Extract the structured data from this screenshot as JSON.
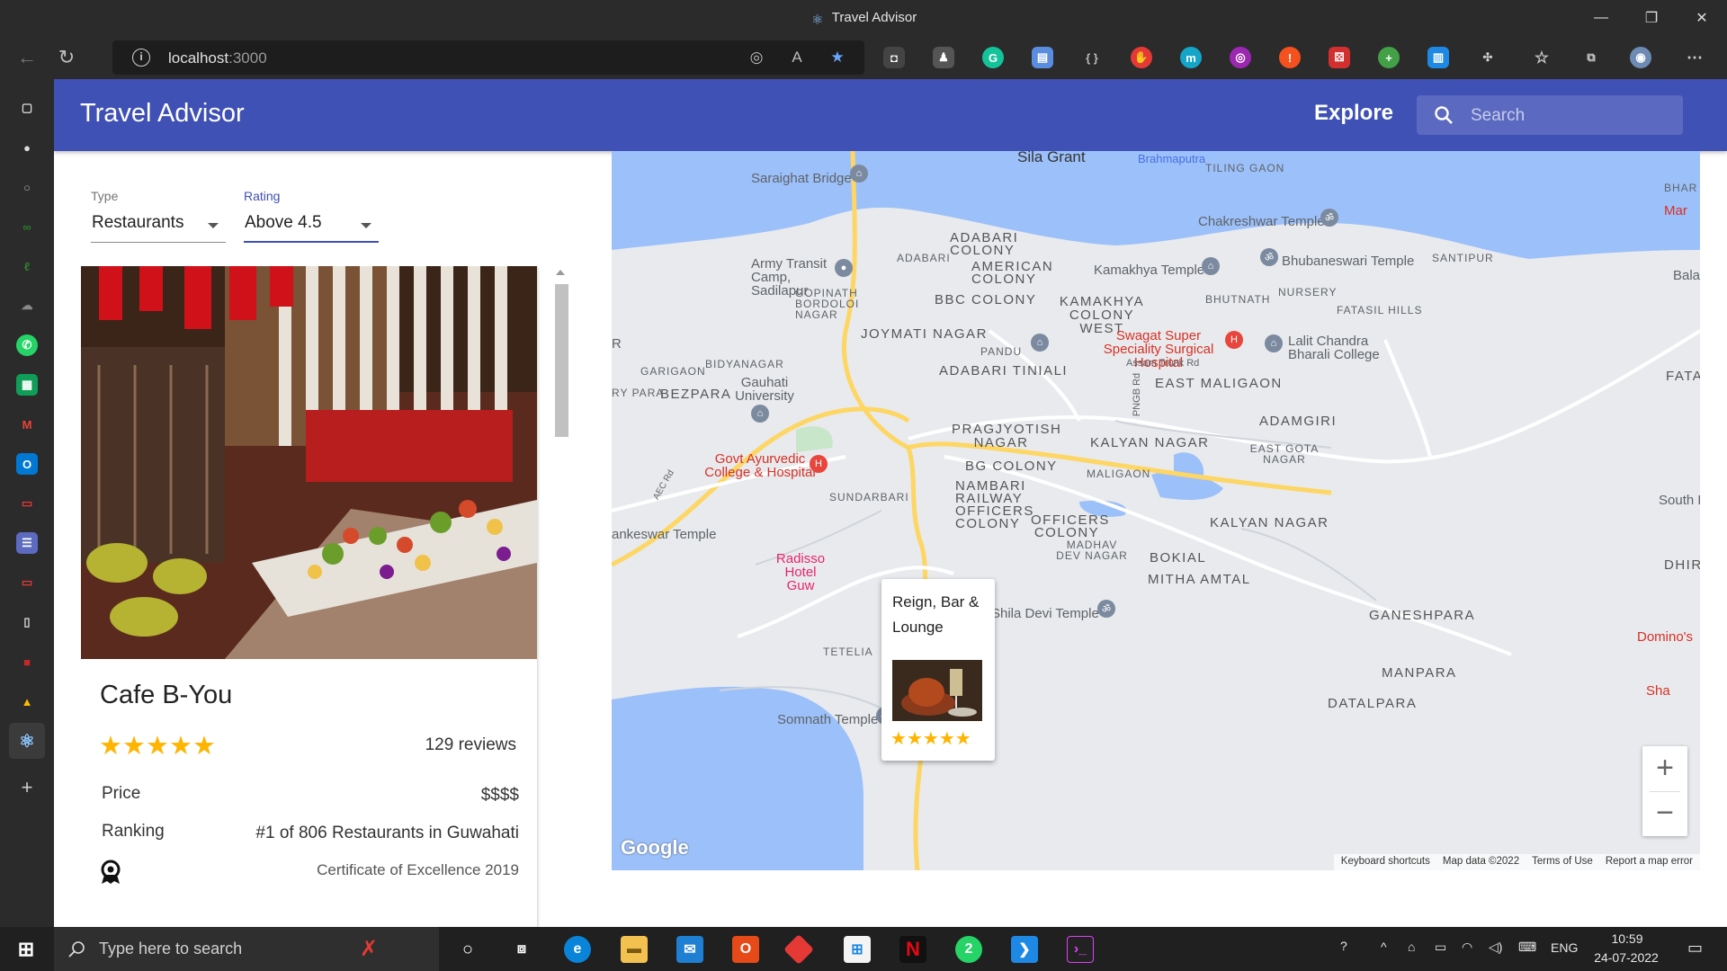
{
  "browser": {
    "window_title": "Travel Advisor",
    "url_host": "localhost",
    "url_port": ":3000"
  },
  "app": {
    "brand": "Travel Advisor",
    "explore_label": "Explore",
    "search_placeholder": "Search"
  },
  "filters": {
    "type_label": "Type",
    "type_value": "Restaurants",
    "rating_label": "Rating",
    "rating_value": "Above 4.5"
  },
  "place": {
    "name": "Cafe B-You",
    "rating_stars": 5,
    "reviews": "129 reviews",
    "price_label": "Price",
    "price_value": "$$$$",
    "ranking_label": "Ranking",
    "ranking_value": "#1 of 806 Restaurants in Guwahati",
    "award": "Certificate of Excellence 2019"
  },
  "map": {
    "popup": {
      "name": "Reign, Bar & Lounge",
      "rating_stars": 5
    },
    "labels": [
      "Sila Grant",
      "Saraighat Bridge",
      "Brahmaputra",
      "TILING GAON",
      "BHAR",
      "Mar",
      "Chakreshwar Temple",
      "ADABARI COLONY",
      "ADABARI",
      "AMERICAN COLONY",
      "Kamakhya Temple",
      "Bhubaneswari Temple",
      "SANTIPUR",
      "Bala",
      "Army Transit Camp, Sadilapur",
      "GOPINATH BORDOLOI NAGAR",
      "BBC COLONY",
      "KAMAKHYA COLONY WEST",
      "BHUTNATH",
      "NURSERY",
      "FATASIL HILLS",
      "JOYMATI NAGAR",
      "PANDU",
      "Swagat Super Speciality Surgical Hospital",
      "Lalit Chandra Bharali College",
      "R",
      "GARIGAON",
      "BIDYANAGAR",
      "ADABARI TINIALI",
      "Assam Trunk Rd",
      "EAST MALIGAON",
      "FATAS",
      "RY PARA",
      "BEZPARA",
      "Gauhati University",
      "PNGB Rd",
      "PRAGJYOTISH NAGAR",
      "ADAMGIRI",
      "KALYAN NAGAR",
      "EAST GOTA NAGAR",
      "Govt Ayurvedic College & Hospital",
      "BG COLONY",
      "MALIGAON",
      "AEC Rd",
      "SUNDARBARI",
      "NAMBARI RAILWAY OFFICERS COLONY",
      "OFFICERS COLONY",
      "South F",
      "ankeswar Temple",
      "KALYAN NAGAR",
      "MADHAV DEV NAGAR",
      "Radisso Hotel Guw",
      "BOKIAL",
      "DHIRENF",
      "MITHA AMTAL",
      "Shila Devi Temple",
      "GANESHPARA",
      "Domino's",
      "TETELIA",
      "MANPARA",
      "Sha",
      "DATALPARA",
      "Somnath Temple"
    ],
    "google_logo": "Google",
    "attribution": [
      "Keyboard shortcuts",
      "Map data ©2022",
      "Terms of Use",
      "Report a map error"
    ]
  },
  "taskbar": {
    "search_placeholder": "Type here to search",
    "language": "ENG",
    "time": "10:59",
    "date": "24-07-2022"
  },
  "colors": {
    "appbar": "#3f51b5",
    "star": "#ffb400",
    "map_water": "#9cc0f9",
    "map_road": "#fdd663"
  }
}
